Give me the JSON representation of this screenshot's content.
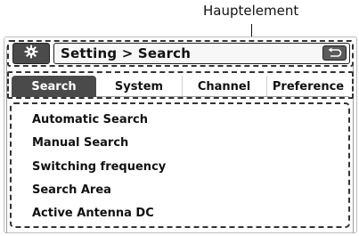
{
  "callout": {
    "label": "Hauptelement"
  },
  "header": {
    "settings_icon": "gear-icon",
    "breadcrumb": "Setting > Search",
    "back_icon": "return-arrow-icon"
  },
  "tabs": [
    {
      "label": "Search",
      "active": true
    },
    {
      "label": "System",
      "active": false
    },
    {
      "label": "Channel",
      "active": false
    },
    {
      "label": "Preference",
      "active": false
    }
  ],
  "menu": {
    "items": [
      {
        "label": "Automatic Search"
      },
      {
        "label": "Manual Search"
      },
      {
        "label": "Switching frequency"
      },
      {
        "label": "Search Area"
      },
      {
        "label": "Active Antenna DC"
      }
    ]
  },
  "colors": {
    "active_tab": "#4a4a4a",
    "outline": "#333333"
  }
}
